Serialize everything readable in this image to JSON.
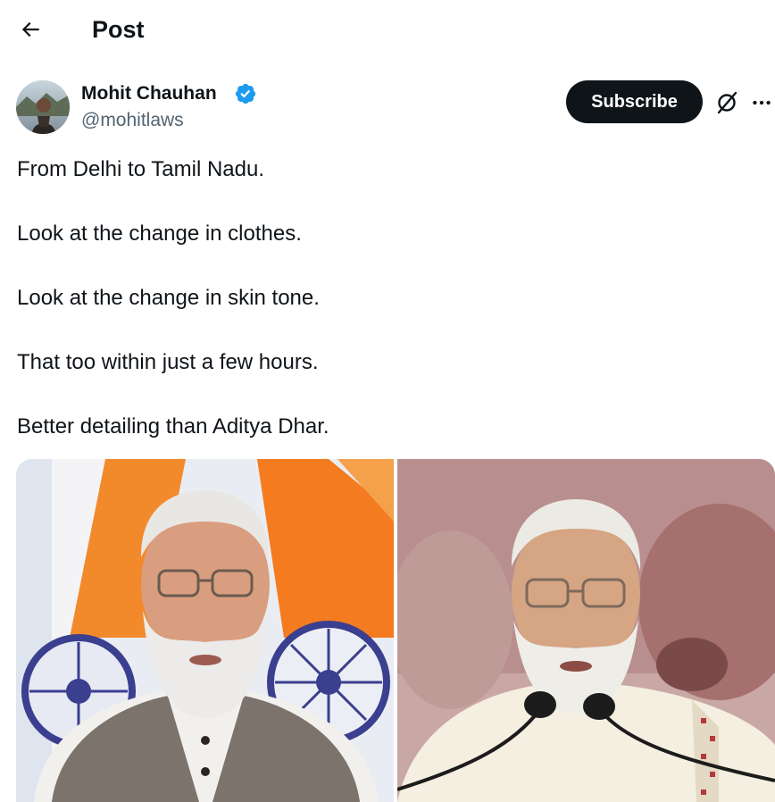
{
  "header": {
    "back_icon": "arrow-left-icon",
    "title": "Post"
  },
  "author": {
    "display_name": "Mohit Chauhan",
    "handle": "@mohitlaws",
    "verified_icon": "verified-badge-icon",
    "verified_color": "#1d9bf0"
  },
  "actions": {
    "subscribe_label": "Subscribe",
    "grok_icon": "grok-icon",
    "more_icon": "more-horizontal-icon"
  },
  "post": {
    "lines": [
      "From Delhi to Tamil Nadu.",
      "Look at the change in clothes.",
      "Look at the change in skin tone.",
      "That too within just a few hours.",
      "Better detailing than Aditya Dhar."
    ]
  },
  "media": {
    "count": 2
  },
  "colors": {
    "text": "#0f1419",
    "secondary": "#536471",
    "button_bg": "#0f1419"
  }
}
